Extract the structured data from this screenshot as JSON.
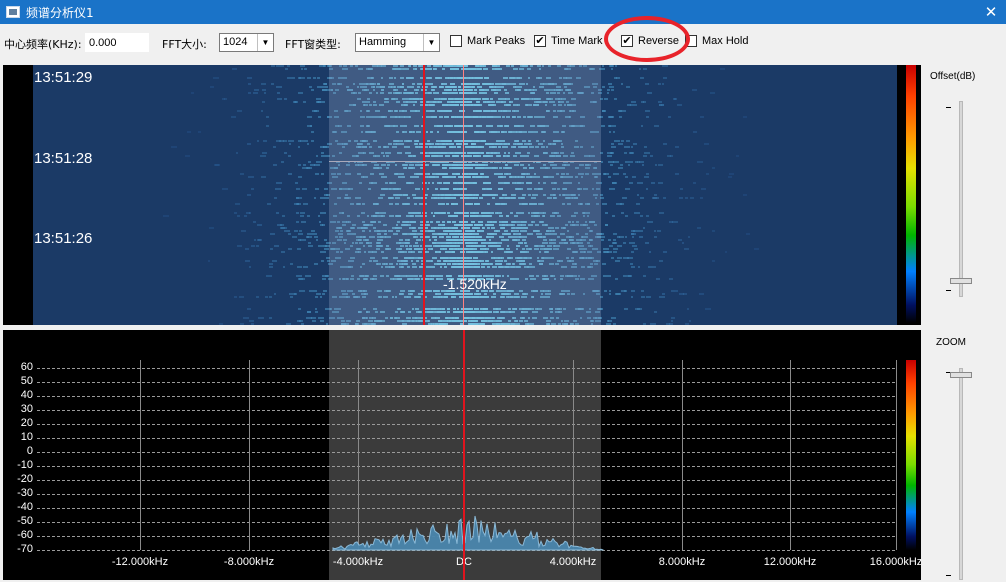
{
  "window": {
    "title": "频谱分析仪1",
    "close_icon": "close-icon"
  },
  "toolbar": {
    "center_freq_label": "中心频率(KHz):",
    "center_freq_value": "0.000",
    "fft_size_label": "FFT大小:",
    "fft_size_value": "1024",
    "fft_window_label": "FFT窗类型:",
    "fft_window_value": "Hamming",
    "mark_peaks_label": "Mark Peaks",
    "mark_peaks_checked": false,
    "time_mark_label": "Time Mark",
    "time_mark_checked": true,
    "reverse_label": "Reverse",
    "reverse_checked": true,
    "max_hold_label": "Max Hold",
    "max_hold_checked": false,
    "check_glyph": "✔"
  },
  "waterfall": {
    "timestamps": [
      "13:51:29",
      "13:51:28",
      "13:51:26"
    ],
    "cursor_freq": "-1.520kHz"
  },
  "controls": {
    "offset_label": "Offset(dB)",
    "offset_level": 0.95,
    "zoom_label": "ZOOM",
    "zoom_level": 0.0
  },
  "spectrum": {
    "y_ticks": [
      "60",
      "50",
      "40",
      "30",
      "20",
      "10",
      "0",
      "-10",
      "-20",
      "-30",
      "-40",
      "-50",
      "-60",
      "-70"
    ],
    "x_ticks": [
      "-12.000kHz",
      "-8.000kHz",
      "-4.000kHz",
      "DC",
      "4.000kHz",
      "8.000kHz",
      "12.000kHz",
      "16.000kHz"
    ]
  },
  "colors": {
    "titlebar": "#1a73c8",
    "waterfall_bg": "#1b3a66",
    "marker_red": "#e0141e",
    "spectrum_fill": "#4a8ab0"
  }
}
